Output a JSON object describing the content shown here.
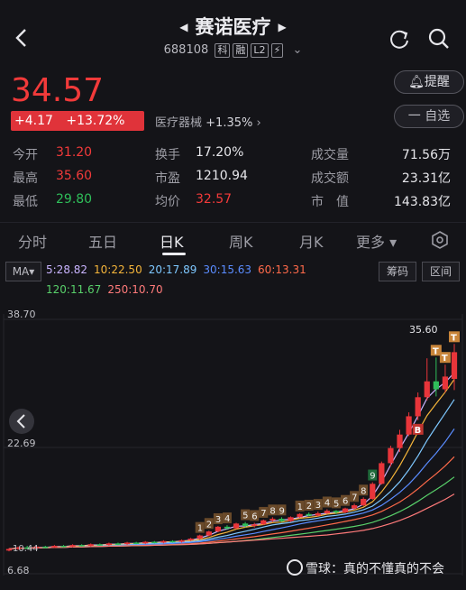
{
  "header": {
    "title": "赛诺医疗",
    "code": "688108",
    "tags": [
      "科",
      "融",
      "L2",
      "⚡"
    ]
  },
  "quote": {
    "price": "34.57",
    "change": "+4.17",
    "change_pct": "+13.72%",
    "sector_name": "医疗器械",
    "sector_pct": "+1.35%",
    "remind_label": "提醒",
    "watch_label": "一 自选"
  },
  "stats": [
    {
      "label": "今开",
      "value": "31.20"
    },
    {
      "label": "最高",
      "value": "35.60"
    },
    {
      "label": "最低",
      "value": "29.80"
    },
    {
      "label": "换手",
      "value": "17.20%"
    },
    {
      "label": "市盈",
      "value": "1210.94"
    },
    {
      "label": "均价",
      "value": "32.57"
    },
    {
      "label": "成交量",
      "value": "71.56万"
    },
    {
      "label": "成交额",
      "value": "23.31亿"
    },
    {
      "label": "市　值",
      "value": "143.83亿"
    }
  ],
  "tabs": [
    "分时",
    "五日",
    "日K",
    "周K",
    "月K",
    "更多 ▾"
  ],
  "active_tab": "日K",
  "ma_selector": "MA",
  "ma_values": [
    {
      "label": "5:28.82",
      "color": "#c9b4ff"
    },
    {
      "label": "10:22.50",
      "color": "#f5b53a"
    },
    {
      "label": "20:17.89",
      "color": "#7ec8ff"
    },
    {
      "label": "30:15.63",
      "color": "#5a8cff"
    },
    {
      "label": "60:13.31",
      "color": "#ff6a4a"
    },
    {
      "label": "120:11.67",
      "color": "#58d06a"
    },
    {
      "label": "250:10.70",
      "color": "#ff7a7a"
    }
  ],
  "chart_buttons": [
    "筹码",
    "区间"
  ],
  "axis": {
    "top": "38.70",
    "mid": "22.69",
    "bottom": "6.68",
    "low_mark": "10.44",
    "high_mark": "35.60"
  },
  "watermark": "雪球：真的不懂真的不会",
  "chart_data": {
    "type": "candlestick",
    "ylim": [
      6.68,
      38.7
    ],
    "candles": [
      [
        9.6,
        9.8,
        9.5,
        9.9
      ],
      [
        9.8,
        10.0,
        9.7,
        10.1
      ],
      [
        10.0,
        9.9,
        9.8,
        10.2
      ],
      [
        9.9,
        10.1,
        9.8,
        10.2
      ],
      [
        10.1,
        10.0,
        9.9,
        10.2
      ],
      [
        10.0,
        10.2,
        9.9,
        10.3
      ],
      [
        10.2,
        10.1,
        10.0,
        10.3
      ],
      [
        10.1,
        10.3,
        10.0,
        10.4
      ],
      [
        10.3,
        10.2,
        10.1,
        10.4
      ],
      [
        10.2,
        10.4,
        10.1,
        10.5
      ],
      [
        10.4,
        10.3,
        10.2,
        10.5
      ],
      [
        10.3,
        10.5,
        10.2,
        10.6
      ],
      [
        10.5,
        10.4,
        10.3,
        10.6
      ],
      [
        10.4,
        10.6,
        10.3,
        10.7
      ],
      [
        10.6,
        10.5,
        10.4,
        10.7
      ],
      [
        10.5,
        10.7,
        10.4,
        10.8
      ],
      [
        10.7,
        10.6,
        10.5,
        10.8
      ],
      [
        10.6,
        10.8,
        10.5,
        10.9
      ],
      [
        10.8,
        10.7,
        10.6,
        10.9
      ],
      [
        10.7,
        10.9,
        10.6,
        11.0
      ],
      [
        10.9,
        11.1,
        10.8,
        11.2
      ],
      [
        11.1,
        11.5,
        11.0,
        11.6
      ],
      [
        11.5,
        12.0,
        11.4,
        12.1
      ],
      [
        12.0,
        12.6,
        11.9,
        12.7
      ],
      [
        12.6,
        12.4,
        12.2,
        12.8
      ],
      [
        12.4,
        13.0,
        12.3,
        13.1
      ],
      [
        13.0,
        12.7,
        12.5,
        13.2
      ],
      [
        12.7,
        12.9,
        12.5,
        13.1
      ],
      [
        12.9,
        13.4,
        12.8,
        13.5
      ],
      [
        13.4,
        13.6,
        13.2,
        13.8
      ],
      [
        13.6,
        13.3,
        13.2,
        13.8
      ],
      [
        13.3,
        13.8,
        13.2,
        13.9
      ],
      [
        13.8,
        14.2,
        13.7,
        14.3
      ],
      [
        14.2,
        14.0,
        13.9,
        14.4
      ],
      [
        14.0,
        14.3,
        13.9,
        14.5
      ],
      [
        14.3,
        14.6,
        14.2,
        14.8
      ],
      [
        14.6,
        14.4,
        14.2,
        14.7
      ],
      [
        14.4,
        14.9,
        14.3,
        15.0
      ],
      [
        14.9,
        15.3,
        14.8,
        15.5
      ],
      [
        15.3,
        16.1,
        15.2,
        16.3
      ],
      [
        16.1,
        18.0,
        16.0,
        18.2
      ],
      [
        18.0,
        20.6,
        17.9,
        20.8
      ],
      [
        20.6,
        22.5,
        20.2,
        22.8
      ],
      [
        22.5,
        24.2,
        22.0,
        24.8
      ],
      [
        24.2,
        26.5,
        24.0,
        27.0
      ],
      [
        26.5,
        28.9,
        26.0,
        29.5
      ],
      [
        28.9,
        30.9,
        28.5,
        33.8
      ],
      [
        30.9,
        29.9,
        29.0,
        33.9
      ],
      [
        29.9,
        31.5,
        29.5,
        33.0
      ],
      [
        31.2,
        34.57,
        29.8,
        35.6
      ]
    ]
  }
}
